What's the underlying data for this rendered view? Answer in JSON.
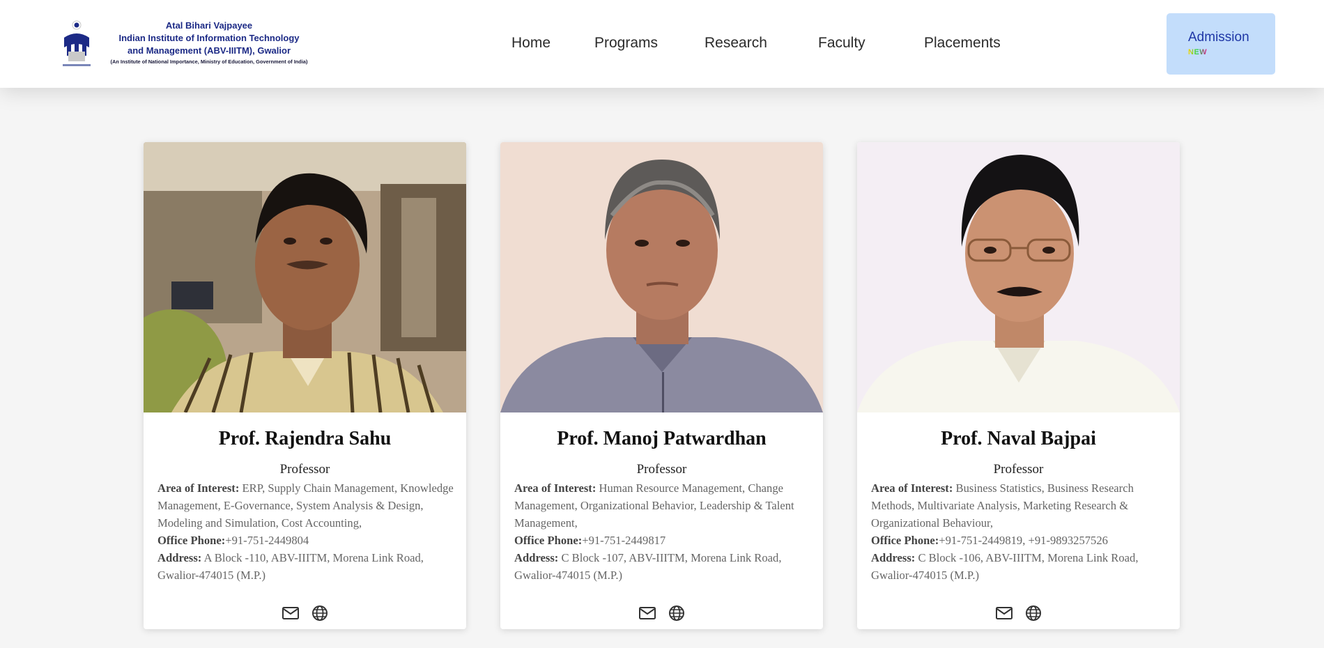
{
  "header": {
    "logo": {
      "line1": "Atal Bihari Vajpayee",
      "line2": "Indian Institute of Information Technology",
      "line3": "and Management (ABV-IIITM), Gwalior",
      "line4": "(An Institute of National Importance, Ministry of Education, Government of India)"
    },
    "nav": [
      "Home",
      "Programs",
      "Research",
      "Faculty",
      "Placements"
    ],
    "admission": {
      "label": "Admission",
      "badge": "NEW"
    }
  },
  "labels": {
    "interest": "Area of Interest:",
    "phone": "Office Phone:",
    "address": "Address:"
  },
  "faculty": [
    {
      "name": "Prof. Rajendra Sahu",
      "title": "Professor",
      "interest": "ERP, Supply Chain Management, Knowledge Management, E-Governance, System Analysis & Design, Modeling and Simulation, Cost Accounting,",
      "phone": "+91-751-2449804",
      "address": "A Block -110, ABV-IIITM, Morena Link Road, Gwalior-474015 (M.P.)"
    },
    {
      "name": "Prof. Manoj Patwardhan",
      "title": "Professor",
      "interest": "Human Resource Management, Change Management, Organizational Behavior, Leadership & Talent Management,",
      "phone": "+91-751-2449817",
      "address": "C Block -107, ABV-IIITM, Morena Link Road, Gwalior-474015 (M.P.)"
    },
    {
      "name": "Prof. Naval Bajpai",
      "title": "Professor",
      "interest": "Business Statistics, Business Research Methods, Multivariate Analysis, Marketing Research & Organizational Behaviour,",
      "phone": "+91-751-2449819, +91-9893257526",
      "address": "C Block -106, ABV-IIITM, Morena Link Road, Gwalior-474015 (M.P.)"
    }
  ],
  "icons": [
    "mail-icon",
    "globe-icon"
  ],
  "colors": {
    "brand_navy": "#1c2a86",
    "admission_bg": "#c3ddfb",
    "admission_text": "#1e36a6",
    "page_bg": "#f5f5f5"
  }
}
